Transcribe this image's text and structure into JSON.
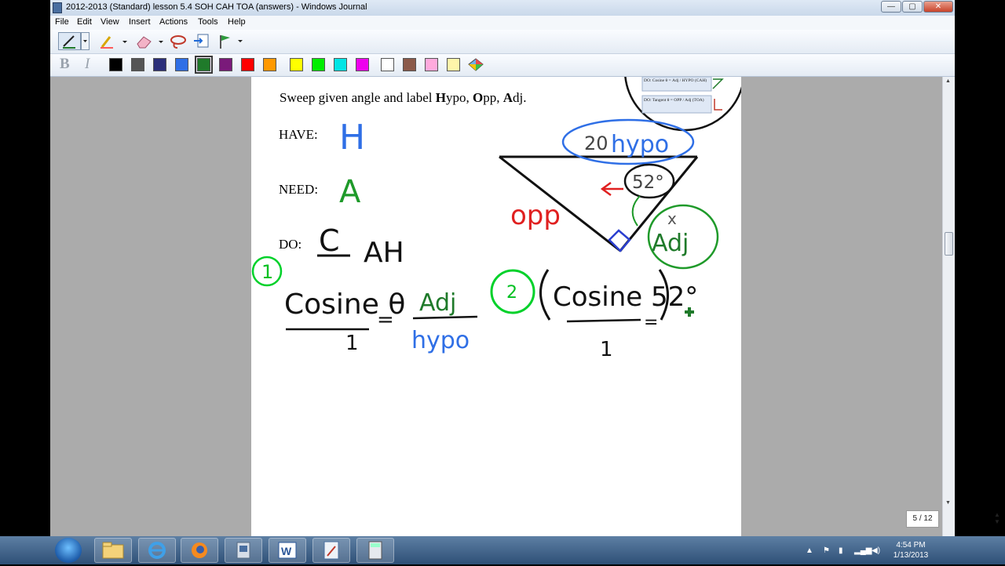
{
  "window": {
    "title": "2012-2013 (Standard) lesson 5.4 SOH CAH TOA (answers) - Windows Journal",
    "controls": {
      "minimize": "—",
      "maximize": "▢",
      "close": "✕"
    }
  },
  "menu": [
    {
      "label": "File"
    },
    {
      "label": "Edit"
    },
    {
      "label": "View"
    },
    {
      "label": "Insert"
    },
    {
      "label": "Actions"
    },
    {
      "label": "Tools"
    },
    {
      "label": "Help"
    }
  ],
  "toolbar": {
    "bold": "B",
    "italic": "I",
    "swatch_colors": [
      "#000000",
      "#555555",
      "#2b2f7a",
      "#2f6fe6",
      "#1f7a2a",
      "#7a1a7a",
      "#ff0000",
      "#ff9900",
      "#ffff00",
      "#00ee00",
      "#00e5e5",
      "#ee00ee",
      "#ffffff",
      "#8b5a4a",
      "#ffaadd",
      "#fff5aa"
    ],
    "selected_color": "#1f7a2a"
  },
  "page": {
    "instruction_pre": "Sweep given angle and label ",
    "h": "H",
    "ypo": "ypo, ",
    "o": "O",
    "pp": "pp, ",
    "a": "A",
    "dj": "dj.",
    "have_label": "HAVE:",
    "need_label": "NEED:",
    "do_label": "DO:",
    "ink": {
      "have": "H",
      "need": "A",
      "do_c": "C",
      "do_rest": "AH",
      "hypo_value": "20",
      "hypo_word": "hypo",
      "angle": "52°",
      "opp": "opp",
      "x": "x",
      "adj": "Adj",
      "step1": "1",
      "step2": "2",
      "cosine_theta": "Cosine θ",
      "eq": "=",
      "one": "1",
      "adj_num": "Adj",
      "hypo_den": "hypo",
      "cosine52": "Cosine 52°"
    },
    "ref_card": {
      "row1": "DO: Cosine θ = Adj / HYPO (CAH)",
      "row2": "DO: Tangent θ = OPP / Adj (TOA)"
    }
  },
  "page_indicator": "5 / 12",
  "taskbar": {
    "time": "4:54 PM",
    "date": "1/13/2013"
  }
}
